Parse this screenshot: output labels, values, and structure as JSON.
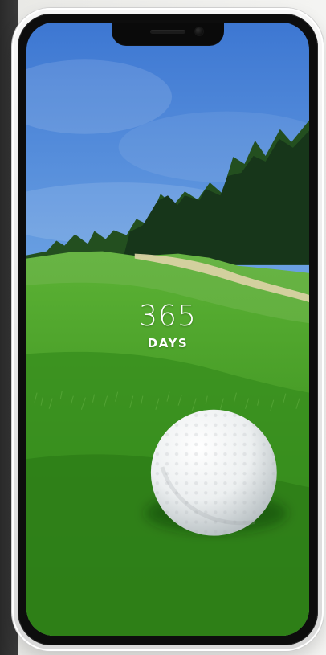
{
  "counter": {
    "value": "365",
    "label": "DAYS"
  }
}
